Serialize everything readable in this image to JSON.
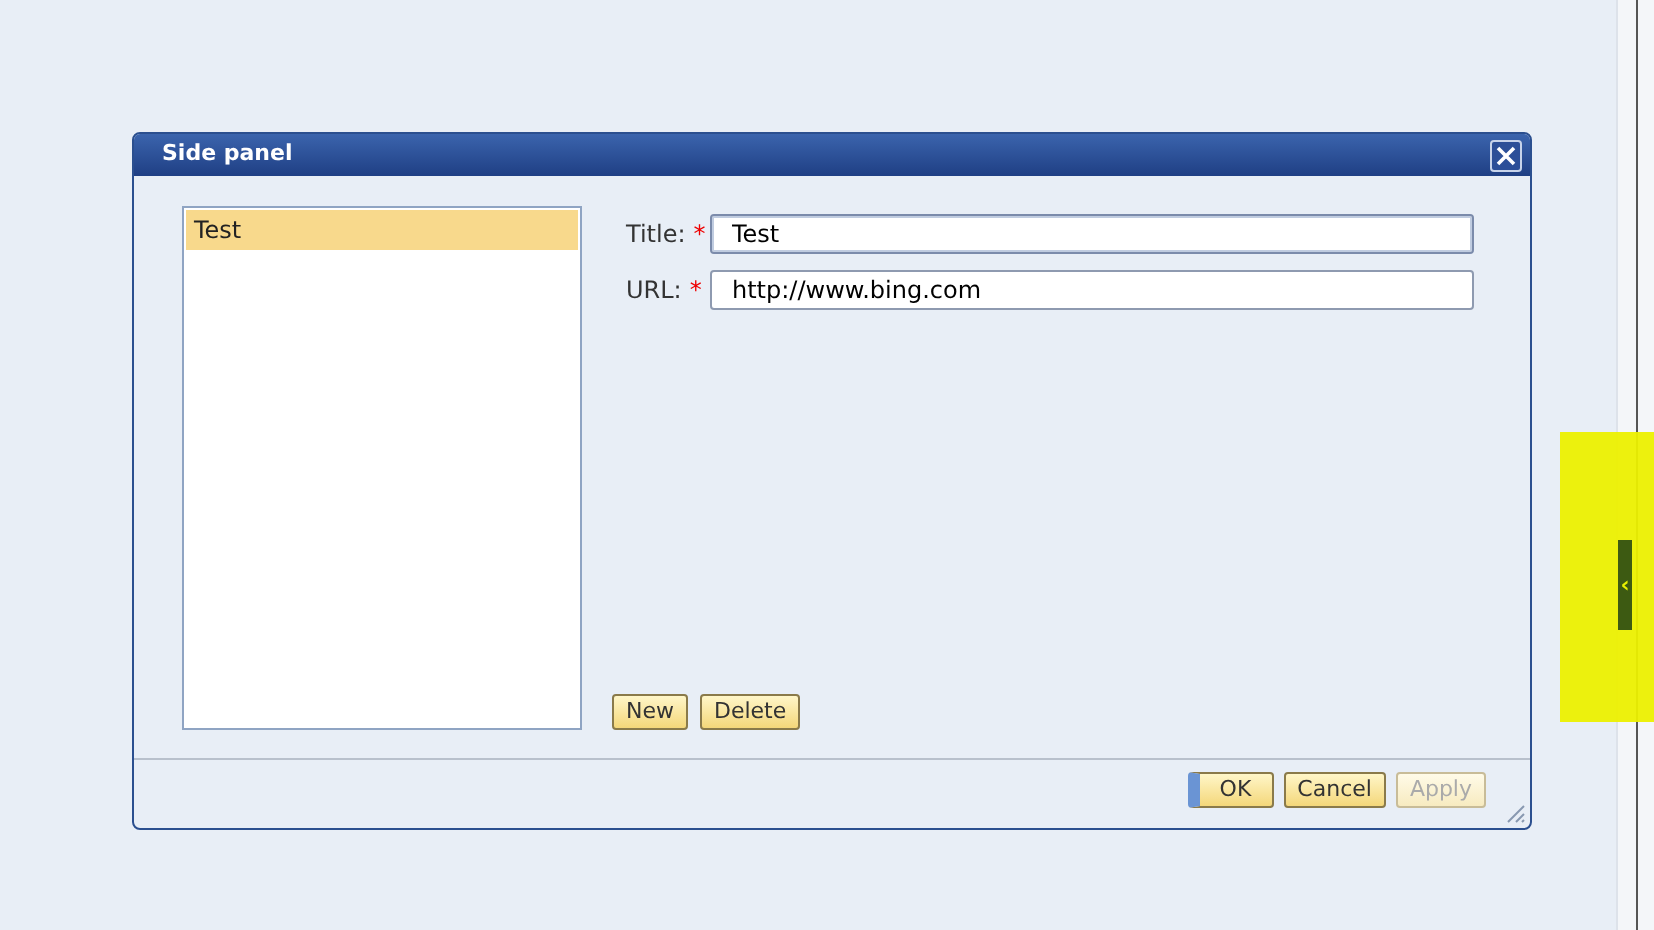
{
  "dialog": {
    "title": "Side panel",
    "list_items": [
      {
        "label": "Test",
        "selected": true
      }
    ],
    "fields": [
      {
        "label": "Title:",
        "required_mark": "*",
        "value": "Test",
        "focused": true
      },
      {
        "label": "URL:",
        "required_mark": "*",
        "value": "http://www.bing.com",
        "focused": false
      }
    ],
    "list_buttons": [
      "New",
      "Delete"
    ],
    "footer_buttons": [
      {
        "label": "OK",
        "kind": "default",
        "disabled": false
      },
      {
        "label": "Cancel",
        "kind": "normal",
        "disabled": false
      },
      {
        "label": "Apply",
        "kind": "normal",
        "disabled": true
      }
    ]
  },
  "side_toggle": {
    "glyph": "‹",
    "highlighted": true
  }
}
